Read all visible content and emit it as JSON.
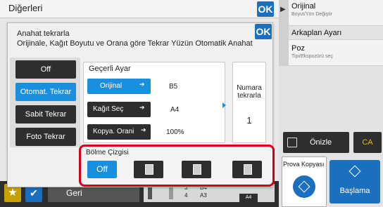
{
  "window": {
    "title": "Diğerleri",
    "ok_label": "OK"
  },
  "dialog": {
    "title": "Anahat tekrarla",
    "description": "Orijinale, Kağıt Boyutu ve Orana göre Tekrar Yüzün Otomatik Anahat",
    "ok_label": "OK",
    "modes": [
      {
        "label": "Off",
        "selected": false
      },
      {
        "label": "Otomat. Tekrar",
        "selected": true
      },
      {
        "label": "Sabit Tekrar",
        "selected": false
      },
      {
        "label": "Foto Tekrar",
        "selected": false
      }
    ],
    "current_settings": {
      "title": "Geçerli Ayar",
      "orijinal_label": "Orijinal",
      "orijinal_value": "B5",
      "kagit_label": "Kağıt Seç",
      "kagit_value": "A4",
      "kopya_label": "Kopya. Orani",
      "kopya_value": "100%"
    },
    "numara": {
      "label_line1": "Numara",
      "label_line2": "tekrarla",
      "value": "1"
    },
    "bolme": {
      "title": "Bölme Çizgisi",
      "off_label": "Off"
    }
  },
  "right_panel": {
    "orijinal_title": "Orijinal",
    "orijinal_sub": "Boyut/Yön Değiştir",
    "arkaplan": "Arkaplan Ayarı",
    "poz_title": "Poz",
    "poz_sub": "Tipi/Ekspozürü seç",
    "onizle": "Önizle",
    "ca": "CA",
    "prova": "Prova Kopyası",
    "baslama": "Başlama"
  },
  "bottom_bar": {
    "star_icon": "star-icon",
    "check_icon": "check-icon",
    "geri": "Geri",
    "tray_numbers": [
      "3",
      "4"
    ],
    "tray_sizes": [
      "B4",
      "A3"
    ],
    "paper_label": "A4"
  },
  "colors": {
    "accent_blue": "#1a8fe0",
    "ok_blue": "#1a6fbf",
    "highlight_red": "#d4001a",
    "dark_button": "#2e2e2e",
    "ca_yellow": "#f0b800"
  }
}
